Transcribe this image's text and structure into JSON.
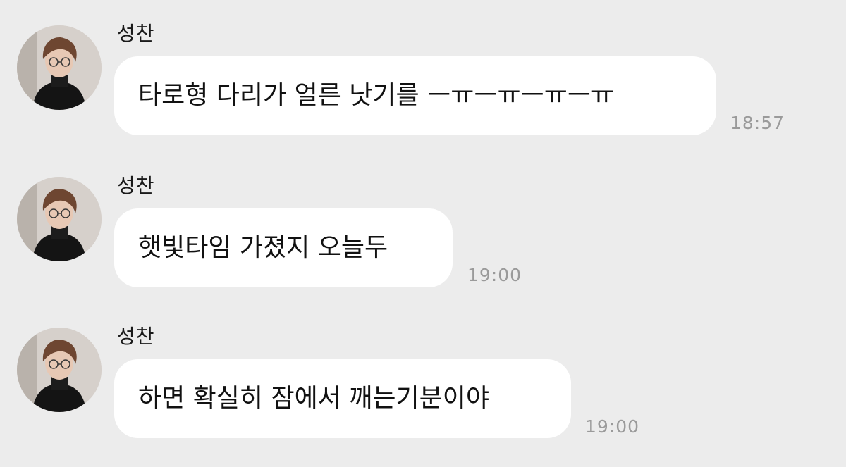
{
  "messages": [
    {
      "sender": "성찬",
      "text": "타로형 다리가 얼른 낫기를 ㅡㅠㅡㅠㅡㅠㅡㅠ",
      "time": "18:57"
    },
    {
      "sender": "성찬",
      "text": "햇빛타임 가졌지 오늘두",
      "time": "19:00"
    },
    {
      "sender": "성찬",
      "text": "하면 확실히 잠에서 깨는기분이야",
      "time": "19:00"
    }
  ],
  "colors": {
    "background": "#ececec",
    "bubble": "#ffffff",
    "timestamp": "#9a9a9a"
  },
  "icons": {
    "avatar": "profile-photo"
  }
}
